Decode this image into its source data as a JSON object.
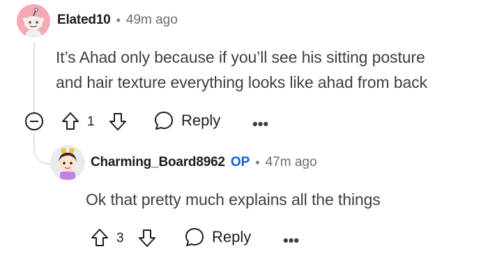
{
  "comment": {
    "username": "Elated10",
    "separator": "•",
    "time": "49m ago",
    "text_line1": "It’s Ahad only because if you’ll see his sitting posture",
    "text_line2": "and hair texture everything looks like ahad from back",
    "votes": "1",
    "reply_label": "Reply",
    "more_label": "•••"
  },
  "reply": {
    "username": "Charming_Board8962",
    "op_badge": "OP",
    "separator": "•",
    "time": "47m ago",
    "text": "Ok that pretty much explains all the things",
    "votes": "3",
    "reply_label": "Reply",
    "more_label": "•••"
  },
  "colors": {
    "op_blue": "#0e5fd8",
    "avatar1_bg": "#f4a9b4",
    "thread_line": "#e0e3e6"
  }
}
